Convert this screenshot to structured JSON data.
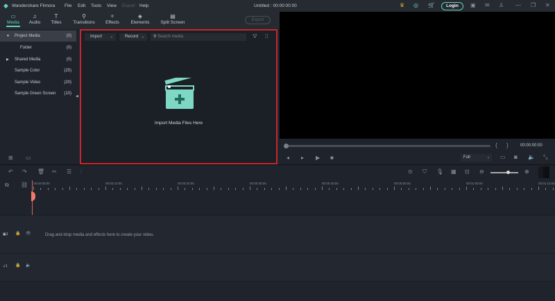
{
  "app": {
    "name": "Wandershare Filmora",
    "project_title": "Untitled : 00:00:00:00",
    "menu": [
      "File",
      "Edit",
      "Tools",
      "View",
      "Export",
      "Help"
    ],
    "login_label": "Login"
  },
  "tabs": [
    {
      "label": "Media",
      "icon": "folder-icon"
    },
    {
      "label": "Audio",
      "icon": "music-icon"
    },
    {
      "label": "Titles",
      "icon": "text-icon"
    },
    {
      "label": "Transitions",
      "icon": "transitions-icon"
    },
    {
      "label": "Effects",
      "icon": "effects-icon"
    },
    {
      "label": "Elements",
      "icon": "elements-icon"
    },
    {
      "label": "Split Screen",
      "icon": "split-screen-icon"
    }
  ],
  "export_label": "Export",
  "sidebar": [
    {
      "label": "Project Media",
      "count": "(0)"
    },
    {
      "label": "Folder",
      "count": "(0)"
    },
    {
      "label": "Shared Media",
      "count": "(0)"
    },
    {
      "label": "Sample Color",
      "count": "(25)"
    },
    {
      "label": "Sample Video",
      "count": "(20)"
    },
    {
      "label": "Sample Green Screen",
      "count": "(10)"
    }
  ],
  "media": {
    "import_label": "Import",
    "record_label": "Record",
    "search_placeholder": "Search media",
    "empty_text": "Import Media Files Here"
  },
  "player": {
    "timecode": "00:00:00:00",
    "quality": "Full",
    "progress": 0
  },
  "timeline": {
    "ticks": [
      "00:00:00:00",
      "00:00:10:00",
      "00:00:20:00",
      "00:00:30:00",
      "00:00:40:00",
      "00:00:50:00",
      "00:01:00:00",
      "00:01:10:00"
    ],
    "drop_hint": "Drag and drop media and effects here to create your video.",
    "video_track": "1",
    "audio_track": "1"
  },
  "colors": {
    "accent": "#5fd6bf",
    "highlight": "#c8262f"
  }
}
